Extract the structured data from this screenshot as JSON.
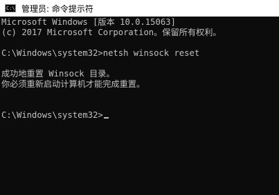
{
  "window": {
    "title": "管理员: 命令提示符",
    "icon": "cmd-icon",
    "icon_label": "C:\\"
  },
  "console": {
    "lines": [
      "Microsoft Windows [版本 10.0.15063]",
      "(c) 2017 Microsoft Corporation。保留所有权利。",
      "",
      "C:\\Windows\\system32>netsh winsock reset",
      "",
      "成功地重置 Winsock 目录。",
      "你必须重新启动计算机才能完成重置。",
      "",
      "",
      "C:\\Windows\\system32>"
    ],
    "background_color": "#0c0c0c",
    "text_color": "#c0c0c0"
  }
}
